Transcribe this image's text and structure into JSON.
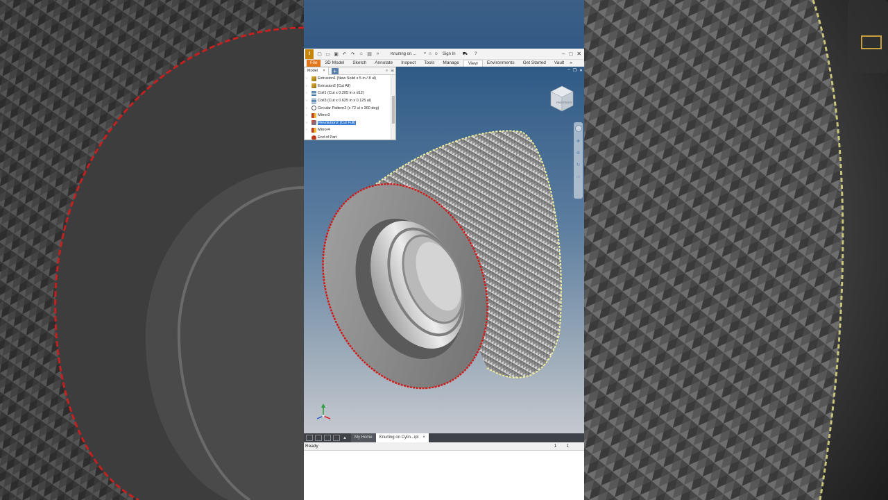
{
  "app": {
    "logo": "I",
    "title": "Knurling on ...",
    "sign_in": "Sign In",
    "help": "?"
  },
  "ribbon": {
    "tabs": [
      "File",
      "3D Model",
      "Sketch",
      "Annotate",
      "Inspect",
      "Tools",
      "Manage",
      "View",
      "Environments",
      "Get Started",
      "Vault"
    ],
    "active_tab": "View",
    "overflow": "»"
  },
  "browser": {
    "tab_label": "Model",
    "close": "×",
    "add": "+",
    "items": [
      {
        "label": "Extrusion1 (New Solid x 5 in / 8 ul)",
        "icon": "extrude-icon"
      },
      {
        "label": "Extrusion2 (Cut All)",
        "icon": "extrude-icon"
      },
      {
        "label": "Coil1 (Cut x 0.205 in x d12)",
        "icon": "coil-icon"
      },
      {
        "label": "Coil3 (Cut x 0.625 in x 0.125 ul)",
        "icon": "coil-icon"
      },
      {
        "label": "Circular Pattern2 (x 72 ul x 360 deg)",
        "icon": "circular-pattern-icon"
      },
      {
        "label": "Mirror3",
        "icon": "mirror-icon"
      },
      {
        "label": "Revolution2 (Cut Full)",
        "icon": "revolve-icon",
        "selected": true
      },
      {
        "label": "Mirror4",
        "icon": "mirror-icon"
      },
      {
        "label": "End of Part",
        "icon": "end-of-part-icon"
      }
    ]
  },
  "viewcube": {
    "front": "FRONT",
    "right": "RIGHT"
  },
  "doc_tabs": {
    "home": "My Home",
    "active": "Knurling on Cylin...ipt",
    "close": "×"
  },
  "status": {
    "text": "Ready",
    "num1": "1",
    "num2": "1"
  },
  "colors": {
    "accent_file": "#e2761b",
    "selection": "#3279d1",
    "knurl_edge_red": "#d11a1a",
    "knurl_edge_yellow": "#f2ef9a"
  }
}
